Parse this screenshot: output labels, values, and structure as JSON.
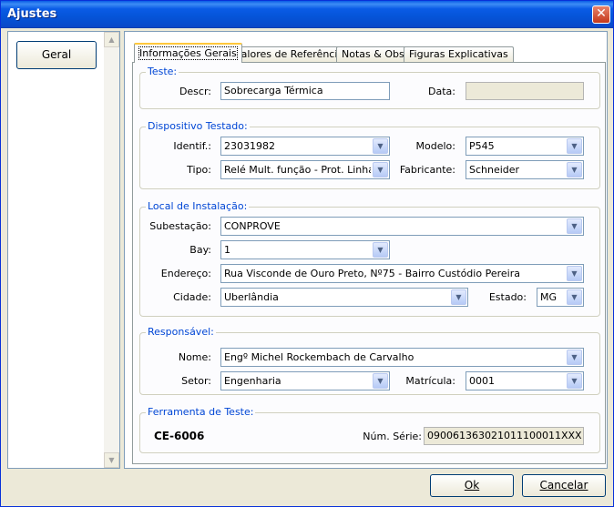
{
  "window": {
    "title": "Ajustes"
  },
  "sidebar": {
    "items": [
      {
        "label": "Geral"
      }
    ]
  },
  "tabs": [
    {
      "label": "Informações Gerais"
    },
    {
      "label": "Valores de Referência"
    },
    {
      "label": "Notas & Obs."
    },
    {
      "label": "Figuras Explicativas"
    }
  ],
  "teste": {
    "title": "Teste:",
    "descr_label": "Descr:",
    "descr_value": "Sobrecarga Térmica",
    "data_label": "Data:",
    "data_value": ""
  },
  "dispositivo": {
    "title": "Dispositivo Testado:",
    "identif_label": "Identif.:",
    "identif_value": "23031982",
    "modelo_label": "Modelo:",
    "modelo_value": "P545",
    "tipo_label": "Tipo:",
    "tipo_value": "Relé Mult. função - Prot. Linha",
    "fabricante_label": "Fabricante:",
    "fabricante_value": "Schneider"
  },
  "local": {
    "title": "Local de Instalação:",
    "subestacao_label": "Subestação:",
    "subestacao_value": "CONPROVE",
    "bay_label": "Bay:",
    "bay_value": "1",
    "endereco_label": "Endereço:",
    "endereco_value": "Rua Visconde de Ouro Preto, Nº75 - Bairro Custódio Pereira",
    "cidade_label": "Cidade:",
    "cidade_value": "Uberlândia",
    "estado_label": "Estado:",
    "estado_value": "MG"
  },
  "responsavel": {
    "title": "Responsável:",
    "nome_label": "Nome:",
    "nome_value": "Engº Michel Rockembach de Carvalho",
    "setor_label": "Setor:",
    "setor_value": "Engenharia",
    "matricula_label": "Matrícula:",
    "matricula_value": "0001"
  },
  "ferramenta": {
    "title": "Ferramenta de Teste:",
    "name": "CE-6006",
    "serie_label": "Núm. Série:",
    "serie_value": "090061363021011100011XXX"
  },
  "footer": {
    "ok_label": "Ok",
    "cancel_label": "Cancelar"
  }
}
